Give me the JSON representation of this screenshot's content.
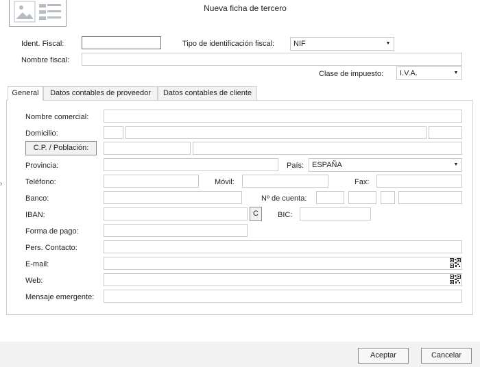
{
  "window": {
    "title": "Nueva ficha de tercero"
  },
  "header": {
    "ident_fiscal_label": "Ident. Fiscal:",
    "ident_fiscal_value": "",
    "tipo_label": "Tipo de identificación fiscal:",
    "tipo_value": "NIF",
    "nombre_fiscal_label": "Nombre fiscal:",
    "nombre_fiscal_value": "",
    "clase_impuesto_label": "Clase de impuesto:",
    "clase_impuesto_value": "I.V.A."
  },
  "tabs": [
    {
      "label": "General",
      "active": true
    },
    {
      "label": "Datos contables de proveedor",
      "active": false
    },
    {
      "label": "Datos contables de cliente",
      "active": false
    }
  ],
  "form": {
    "nombre_comercial_label": "Nombre comercial:",
    "domicilio_label": "Domicilio:",
    "cp_button": "C.P. / Población:",
    "provincia_label": "Provincia:",
    "pais_label": "País:",
    "pais_value": "ESPAÑA",
    "telefono_label": "Teléfono:",
    "movil_label": "Móvil:",
    "fax_label": "Fax:",
    "banco_label": "Banco:",
    "cuenta_label": "Nº de cuenta:",
    "iban_label": "IBAN:",
    "iban_button": "C",
    "bic_label": "BIC:",
    "forma_pago_label": "Forma de pago:",
    "contacto_label": "Pers. Contacto:",
    "email_label": "E-mail:",
    "web_label": "Web:",
    "mensaje_label": "Mensaje emergente:"
  },
  "footer": {
    "accept_label": "Aceptar",
    "cancel_label": "Cancelar"
  },
  "icons": {
    "header_image": "contact-card-icon",
    "qr": "qr-code-icon",
    "dropdown": "chevron-down-icon",
    "side_expander": "chevron-right-icon"
  }
}
